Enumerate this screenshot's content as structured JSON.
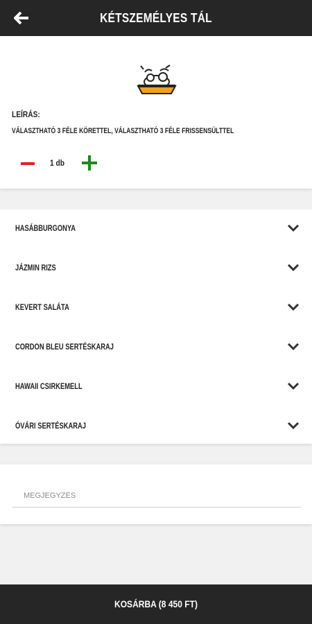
{
  "header": {
    "title": "Kétszemélyes tál",
    "back_icon": "arrow-left-icon"
  },
  "product": {
    "icon": "food-platter-icon",
    "description_label": "Leírás:",
    "description": "Választható 3 féle körettel, választható 3 féle frissensülttel",
    "quantity": "1 db",
    "colors": {
      "minus": "#e02020",
      "plus": "#1a8a1a",
      "platter": "#f0a020"
    }
  },
  "options": [
    {
      "label": "Hasábburgonya"
    },
    {
      "label": "Jázmin rizs"
    },
    {
      "label": "Kevert saláta"
    },
    {
      "label": "Cordon bleu sertéskaraj"
    },
    {
      "label": "Hawaii csirkemell"
    },
    {
      "label": "Óvári sertéskaraj"
    }
  ],
  "note": {
    "placeholder": "Megjegyzés"
  },
  "footer": {
    "cart_label": "Kosárba (8 450 Ft)"
  },
  "theme": {
    "bar_color": "#262626",
    "background": "#f1f1f1"
  }
}
